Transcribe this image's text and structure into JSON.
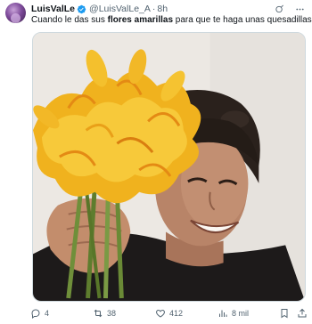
{
  "tweet": {
    "author": {
      "display_name": "LuisValLe",
      "handle": "@LuisValLe_A",
      "separator": "·",
      "time": "8h"
    },
    "text_before": "Cuando le das sus ",
    "text_bold": "flores amarillas",
    "text_after": " para que te haga unas quesadillas",
    "media_icon": "photo-woman-holding-squash-blossoms",
    "stats": {
      "replies": "4",
      "retweets": "38",
      "likes": "412",
      "views": "8 mil"
    }
  },
  "icons": {
    "grok": "grok-icon",
    "more": "more-icon",
    "reply": "reply-icon",
    "retweet": "retweet-icon",
    "like": "heart-icon",
    "views": "views-icon",
    "bookmark": "bookmark-icon",
    "share": "share-icon"
  },
  "colors": {
    "text": "#0f1419",
    "secondary": "#536471",
    "verified": "#1d9bf0",
    "border": "#cfd9de"
  }
}
